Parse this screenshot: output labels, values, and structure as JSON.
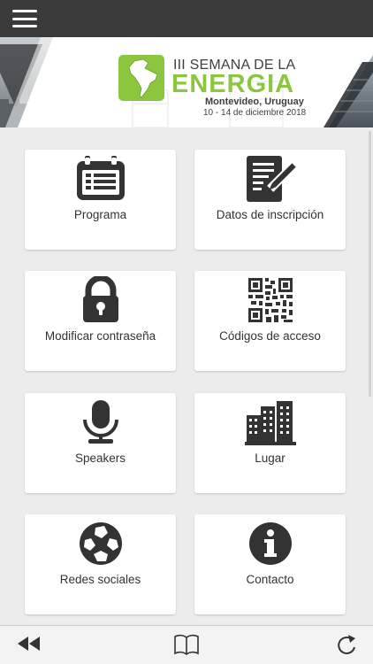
{
  "header": {
    "menu_icon": "hamburger-menu-icon"
  },
  "banner": {
    "line1": "III SEMANA DE LA",
    "line2": "ENERGIA",
    "line3": "Montevideo, Uruguay",
    "line4": "10 - 14 de diciembre 2018",
    "accent": "#8cc63f"
  },
  "tiles": [
    {
      "label": "Programa",
      "icon": "calendar-icon"
    },
    {
      "label": "Datos de inscripción",
      "icon": "form-edit-icon"
    },
    {
      "label": "Modificar contraseña",
      "icon": "lock-icon"
    },
    {
      "label": "Códigos de acceso",
      "icon": "qr-code-icon"
    },
    {
      "label": "Speakers",
      "icon": "microphone-icon"
    },
    {
      "label": "Lugar",
      "icon": "buildings-icon"
    },
    {
      "label": "Redes sociales",
      "icon": "social-ball-icon"
    },
    {
      "label": "Contacto",
      "icon": "info-icon"
    }
  ],
  "bottom_bar": {
    "back": "rewind-back-icon",
    "book": "book-icon",
    "refresh": "refresh-icon"
  },
  "colors": {
    "topbar": "#3b3b3b",
    "icon": "#333333"
  }
}
